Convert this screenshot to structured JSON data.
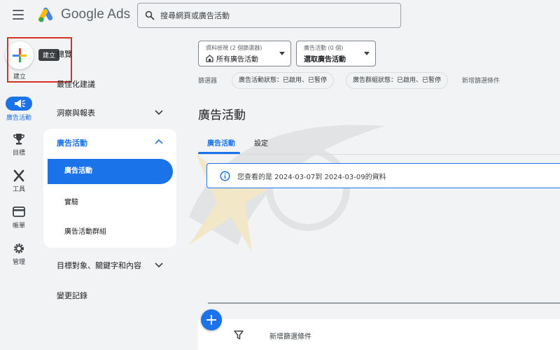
{
  "header": {
    "brand": "Google Ads",
    "search_placeholder": "搜尋網頁或廣告活動"
  },
  "create": {
    "label": "建立",
    "tooltip": "建立"
  },
  "rail": {
    "items": [
      {
        "label": "廣告活動",
        "icon": "megaphone-icon",
        "active": true
      },
      {
        "label": "目標",
        "icon": "trophy-icon"
      },
      {
        "label": "工具",
        "icon": "tools-icon"
      },
      {
        "label": "帳單",
        "icon": "credit-card-icon"
      },
      {
        "label": "管理",
        "icon": "gear-icon"
      }
    ]
  },
  "nav": {
    "overview": "總覽",
    "recommendations": "最佳化建議",
    "insights": "洞察與報表",
    "campaigns_group": {
      "title": "廣告活動",
      "items": [
        "廣告活動",
        "實驗",
        "廣告活動群組"
      ]
    },
    "audiences": "目標對象、關鍵字和內容",
    "change_history": "變更記錄"
  },
  "toolbar": {
    "view_dropdown": {
      "small": "資料檢視 (2 個篩選器)",
      "main": "所有廣告活動"
    },
    "campaign_dropdown": {
      "small": "廣告活動 (0 個)",
      "main": "選取廣告活動"
    }
  },
  "filters": {
    "label": "篩選器",
    "chips": [
      "廣告活動狀態：已啟用、已暫停",
      "廣告群組狀態：已啟用、已暫停"
    ],
    "add": "新增篩選條件"
  },
  "main": {
    "title": "廣告活動",
    "tabs": [
      "廣告活動",
      "設定"
    ],
    "info": "您查看的是 2024-03-07到 2024-03-09的資料",
    "bottom_add_filter": "新增篩選條件"
  },
  "colors": {
    "accent": "#1a73e8",
    "highlight_box": "#d93025"
  }
}
